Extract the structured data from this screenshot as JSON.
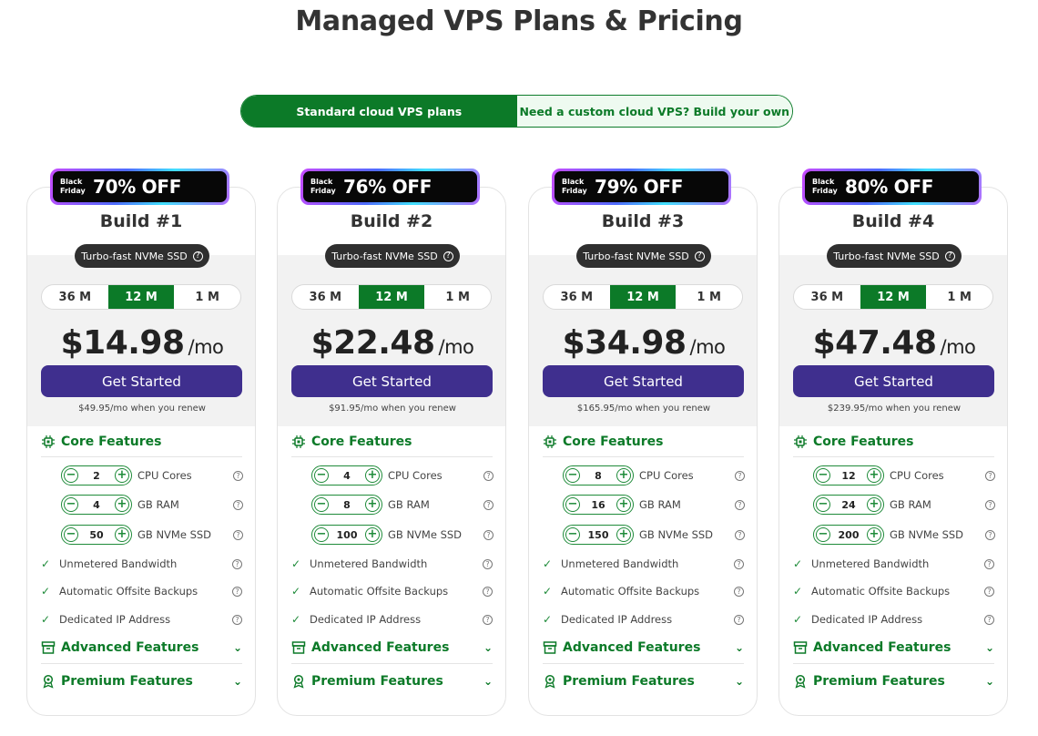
{
  "page": {
    "title": "Managed VPS Plans & Pricing"
  },
  "toggle": {
    "standard": "Standard cloud VPS plans",
    "custom": "Need a custom cloud VPS? Build your own"
  },
  "common": {
    "badge_line1": "Black",
    "badge_line2": "Friday",
    "storage_pill": "Turbo-fast NVMe SSD",
    "terms": [
      "36 M",
      "12 M",
      "1 M"
    ],
    "selected_term": "12 M",
    "per": "/mo",
    "cta": "Get Started",
    "core_features": "Core Features",
    "cpu_label": "CPU Cores",
    "ram_label": "GB RAM",
    "ssd_label": "GB NVMe SSD",
    "bandwidth": "Unmetered Bandwidth",
    "backups": "Automatic Offsite Backups",
    "ip": "Dedicated IP Address",
    "advanced": "Advanced Features",
    "premium": "Premium Features",
    "help_glyph": "?",
    "minus": "−",
    "plus": "+",
    "check": "✓",
    "chevron": "⌄"
  },
  "plans": [
    {
      "discount": "70% OFF",
      "name": "Build #1",
      "price": "$14.98",
      "renew": "$49.95/mo when you renew",
      "cpu": "2",
      "ram": "4",
      "ssd": "50"
    },
    {
      "discount": "76% OFF",
      "name": "Build #2",
      "price": "$22.48",
      "renew": "$91.95/mo when you renew",
      "cpu": "4",
      "ram": "8",
      "ssd": "100"
    },
    {
      "discount": "79% OFF",
      "name": "Build #3",
      "price": "$34.98",
      "renew": "$165.95/mo when you renew",
      "cpu": "8",
      "ram": "16",
      "ssd": "150"
    },
    {
      "discount": "80% OFF",
      "name": "Build #4",
      "price": "$47.48",
      "renew": "$239.95/mo when you renew",
      "cpu": "12",
      "ram": "24",
      "ssd": "200"
    }
  ],
  "colors": {
    "brand_green": "#0c7a28",
    "cta_purple": "#3f2f8e",
    "pill_dark": "#2f2f2f"
  }
}
